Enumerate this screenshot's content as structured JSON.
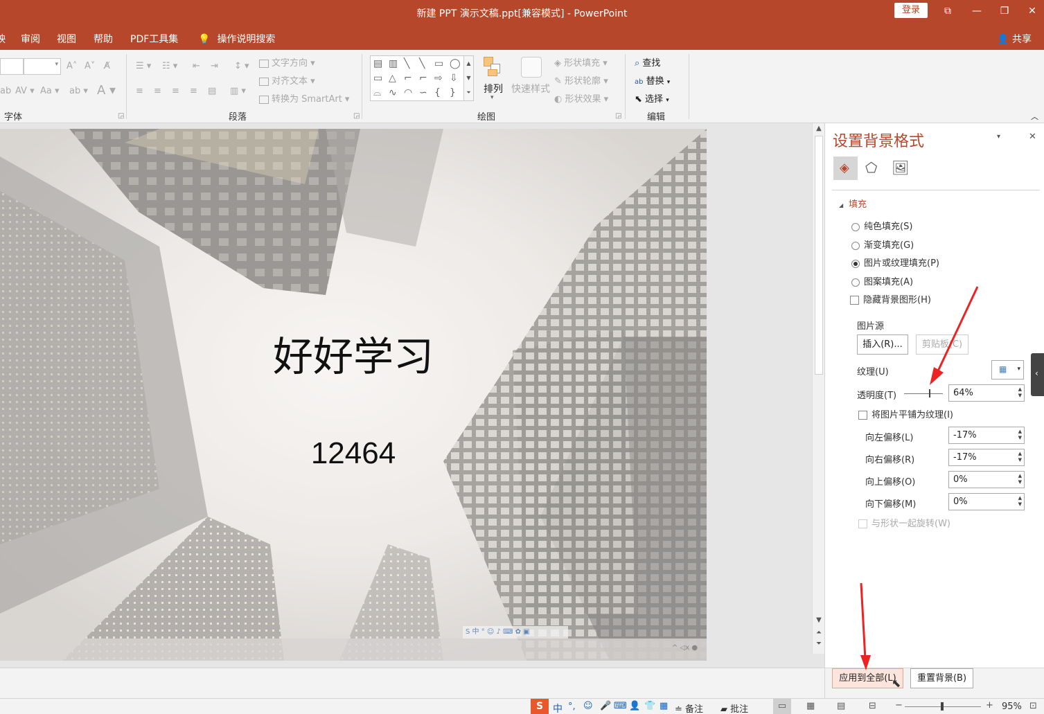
{
  "window": {
    "title": "新建 PPT 演示文稿.ppt[兼容模式]  -  PowerPoint",
    "login_label": "登录",
    "share_label": "共享"
  },
  "menu": {
    "left_fragment": "映",
    "items": [
      "审阅",
      "视图",
      "帮助",
      "PDF工具集"
    ],
    "tell_me": "操作说明搜索"
  },
  "ribbon": {
    "font_group": "字体",
    "paragraph_group": "段落",
    "drawing_group": "绘图",
    "editing_group": "编辑",
    "text_direction": "文字方向",
    "align_text": "对齐文本",
    "convert_smartart": "转换为 SmartArt",
    "arrange": "排列",
    "quick_styles": "快速样式",
    "shape_fill": "形状填充",
    "shape_outline": "形状轮廓",
    "shape_effects": "形状效果",
    "find": "查找",
    "replace": "替换",
    "select": "选择"
  },
  "slide": {
    "title": "好好学习",
    "subtitle": "12464"
  },
  "pane": {
    "title": "设置背景格式",
    "section_fill": "填充",
    "opt_solid": "纯色填充(S)",
    "opt_gradient": "渐变填充(G)",
    "opt_picture": "图片或纹理填充(P)",
    "opt_pattern": "图案填充(A)",
    "opt_hide_bg": "隐藏背景图形(H)",
    "picture_source": "图片源",
    "insert_btn": "插入(R)...",
    "clipboard_btn": "剪贴板(C)",
    "texture": "纹理(U)",
    "transparency_label": "透明度(T)",
    "transparency_value": "64%",
    "transparency": 0.64,
    "tile_label": "将图片平铺为纹理(I)",
    "offset_left_label": "向左偏移(L)",
    "offset_left": "-17%",
    "offset_right_label": "向右偏移(R)",
    "offset_right": "-17%",
    "offset_top_label": "向上偏移(O)",
    "offset_top": "0%",
    "offset_bottom_label": "向下偏移(M)",
    "offset_bottom": "0%",
    "rotate_with_shape": "与形状一起旋转(W)",
    "apply_all": "应用到全部(L)",
    "reset_bg": "重置背景(B)"
  },
  "status": {
    "notes": "备注",
    "comments": "批注",
    "zoom": "95%",
    "ime": "中"
  },
  "colors": {
    "accent": "#b7472a",
    "arrow": "#ee2222"
  }
}
